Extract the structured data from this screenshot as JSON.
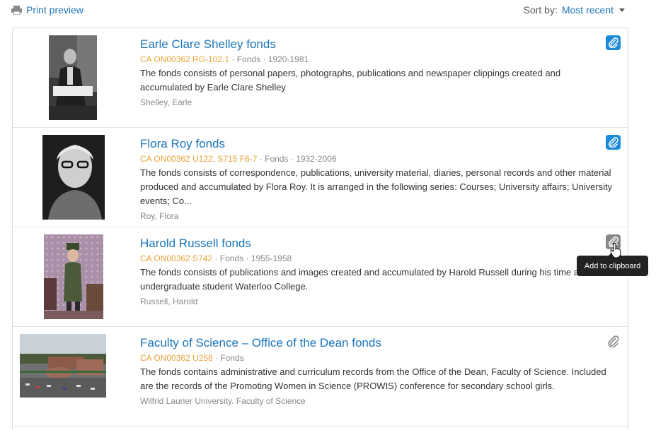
{
  "toolbar": {
    "print_label": "Print preview",
    "sort_label": "Sort by:",
    "sort_value": "Most recent"
  },
  "tooltip": "Add to clipboard",
  "colors": {
    "link": "#1a75bb",
    "reference": "#e8a33a",
    "clipboard_active": "#1a8bd8"
  },
  "results": [
    {
      "title": "Earle Clare Shelley fonds",
      "reference": "CA ON00362 RG-102.1",
      "level": "Fonds",
      "dates": "1920-1981",
      "description": "The fonds consists of personal papers, photographs, publications and newspaper clippings created and accumulated by Earle Clare Shelley",
      "creator": "Shelley, Earle",
      "clipboard": "added"
    },
    {
      "title": "Flora Roy fonds",
      "reference": "CA ON00362 U122, S715 F6-7",
      "level": "Fonds",
      "dates": "1932-2006",
      "description": "The fonds consists of correspondence, publications, university material, diaries, personal records and other material produced and accumulated by Flora Roy. It is arranged in the following series: Courses; University affairs; University events; Co...",
      "creator": "Roy, Flora",
      "clipboard": "added"
    },
    {
      "title": "Harold Russell fonds",
      "reference": "CA ON00362 S742",
      "level": "Fonds",
      "dates": "1955-1958",
      "description": "The fonds consists of publications and images created and accumulated by Harold Russell during his time as an undergraduate student Waterloo College.",
      "creator": "Russell, Harold",
      "clipboard": "hover"
    },
    {
      "title": "Faculty of Science – Office of the Dean fonds",
      "reference": "CA ON00362 U258",
      "level": "Fonds",
      "dates": "",
      "description": "The fonds contains administrative and curriculum records from the Office of the Dean, Faculty of Science. Included are the records of the Promoting Women in Science (PROWIS) conference for secondary school girls.",
      "creator": "Wilfrid Laurier University. Faculty of Science",
      "clipboard": "none"
    }
  ]
}
